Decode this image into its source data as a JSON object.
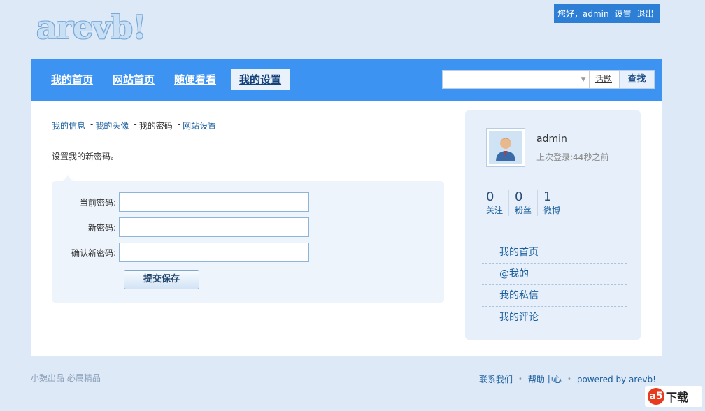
{
  "userbar": {
    "greeting": "您好，admin",
    "settings": "设置",
    "logout": "退出"
  },
  "logo": {
    "text": "arevb!"
  },
  "nav": {
    "items": [
      {
        "label": "我的首页"
      },
      {
        "label": "网站首页"
      },
      {
        "label": "随便看看"
      },
      {
        "label": "我的设置",
        "active": true
      }
    ],
    "search": {
      "placeholder": "",
      "scope": "话题",
      "button": "查找"
    }
  },
  "breadcrumb": {
    "items": [
      "我的信息",
      "我的头像",
      "我的密码",
      "网站设置"
    ],
    "current_index": 2
  },
  "intro": "设置我的新密码。",
  "form": {
    "fields": [
      {
        "label": "当前密码:",
        "value": ""
      },
      {
        "label": "新密码:",
        "value": ""
      },
      {
        "label": "确认新密码:",
        "value": ""
      }
    ],
    "submit": "提交保存"
  },
  "profile": {
    "username": "admin",
    "last_login": "上次登录:44秒之前",
    "stats": [
      {
        "num": "0",
        "label": "关注"
      },
      {
        "num": "0",
        "label": "粉丝"
      },
      {
        "num": "1",
        "label": "微博"
      }
    ],
    "menu": [
      "我的首页",
      "@我的",
      "我的私信",
      "我的评论"
    ]
  },
  "footer": {
    "left": "小魏出品  必属精品",
    "links": [
      "联系我们",
      "帮助中心"
    ],
    "powered": "powered by arevb!"
  },
  "watermark": {
    "badge": "a5",
    "text": "下载"
  },
  "colors": {
    "page_bg": "#dde9f7",
    "nav_bg": "#3d93f2",
    "accent": "#1a5e9e"
  }
}
